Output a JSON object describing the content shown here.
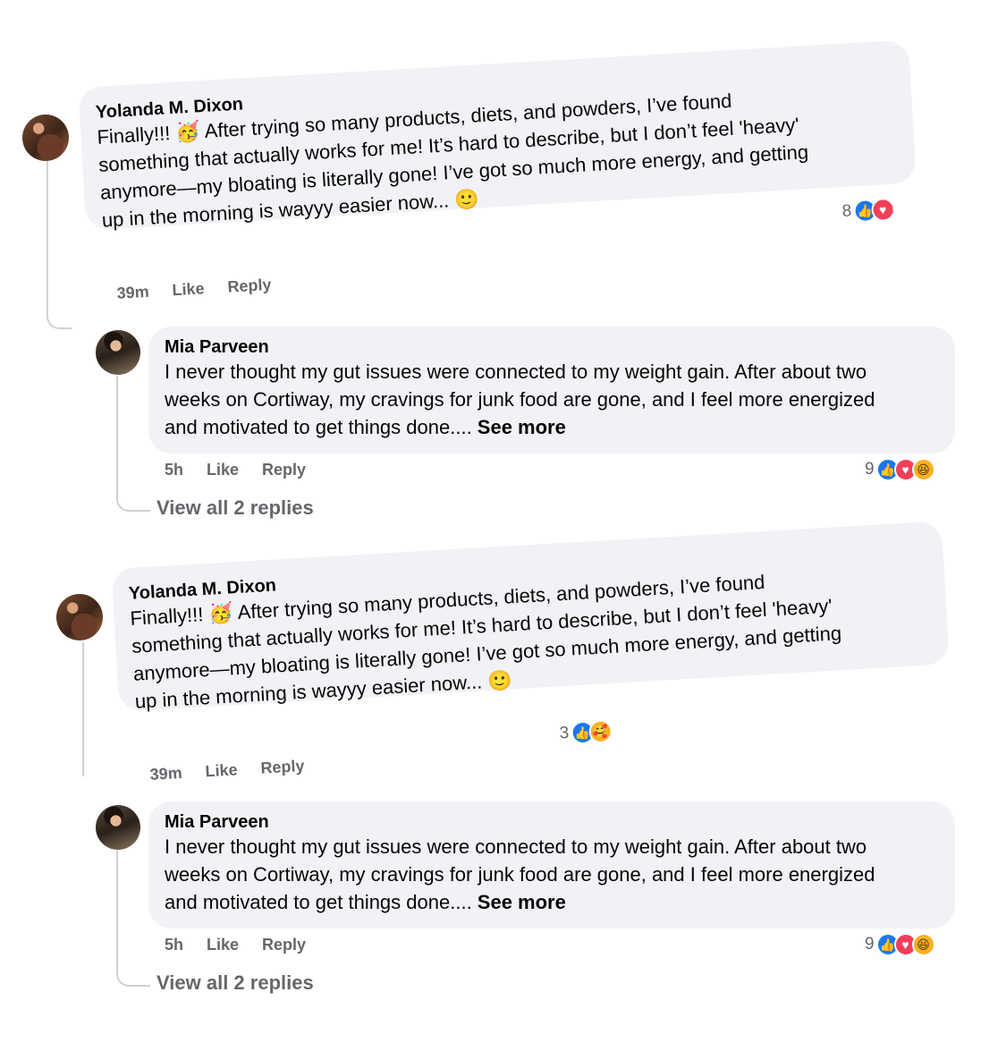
{
  "comments": [
    {
      "author": "Yolanda M. Dixon",
      "text_lines": [
        "Finally!!! 🥳 After trying so many products, diets, and powders, I’ve found",
        "something that actually works for me! It’s hard to describe, but I don’t feel 'heavy'",
        "anymore—my bloating is literally gone! I’ve got so much more energy, and getting",
        "up in the morning is wayyy easier now... 🙂"
      ],
      "time": "39m",
      "like_label": "Like",
      "reply_label": "Reply",
      "reaction_count": "8",
      "reaction_icons": [
        "like-icon",
        "love-icon"
      ]
    },
    {
      "author": "Mia Parveen",
      "text_lines": [
        "I never thought my gut issues were connected to my weight gain. After about two",
        "weeks on Cortiway, my cravings for junk food are gone, and I feel more energized",
        "and motivated to get things done.... "
      ],
      "see_more": "See more",
      "time": "5h",
      "like_label": "Like",
      "reply_label": "Reply",
      "reaction_count": "9",
      "reaction_icons": [
        "like-icon",
        "love-icon",
        "haha-icon"
      ],
      "view_replies": "View all 2 replies"
    },
    {
      "author": "Yolanda M. Dixon",
      "text_lines": [
        "Finally!!! 🥳 After trying so many products, diets, and powders, I’ve found",
        "something that actually works for me! It’s hard to describe, but I don’t feel 'heavy'",
        "anymore—my bloating is literally gone! I’ve got so much more energy, and getting",
        "up in the morning is wayyy easier now... 🙂"
      ],
      "time": "39m",
      "like_label": "Like",
      "reply_label": "Reply",
      "reaction_count": "3",
      "reaction_icons": [
        "like-icon",
        "care-icon"
      ]
    },
    {
      "author": "Mia Parveen",
      "text_lines": [
        "I never thought my gut issues were connected to my weight gain. After about two",
        "weeks on Cortiway, my cravings for junk food are gone, and I feel more energized",
        "and motivated to get things done.... "
      ],
      "see_more": "See more",
      "time": "5h",
      "like_label": "Like",
      "reply_label": "Reply",
      "reaction_count": "9",
      "reaction_icons": [
        "like-icon",
        "love-icon",
        "haha-icon"
      ],
      "view_replies": "View all 2 replies"
    }
  ],
  "icons": {
    "like-icon": "👍",
    "love-icon": "♥",
    "haha-icon": "😆",
    "care-icon": "🥰"
  },
  "colors": {
    "bubble": "#f0f2f5",
    "meta_text": "#65676b",
    "like_blue": "#1877f2",
    "love_red": "#f33e58",
    "haha_yellow": "#f7b125"
  }
}
